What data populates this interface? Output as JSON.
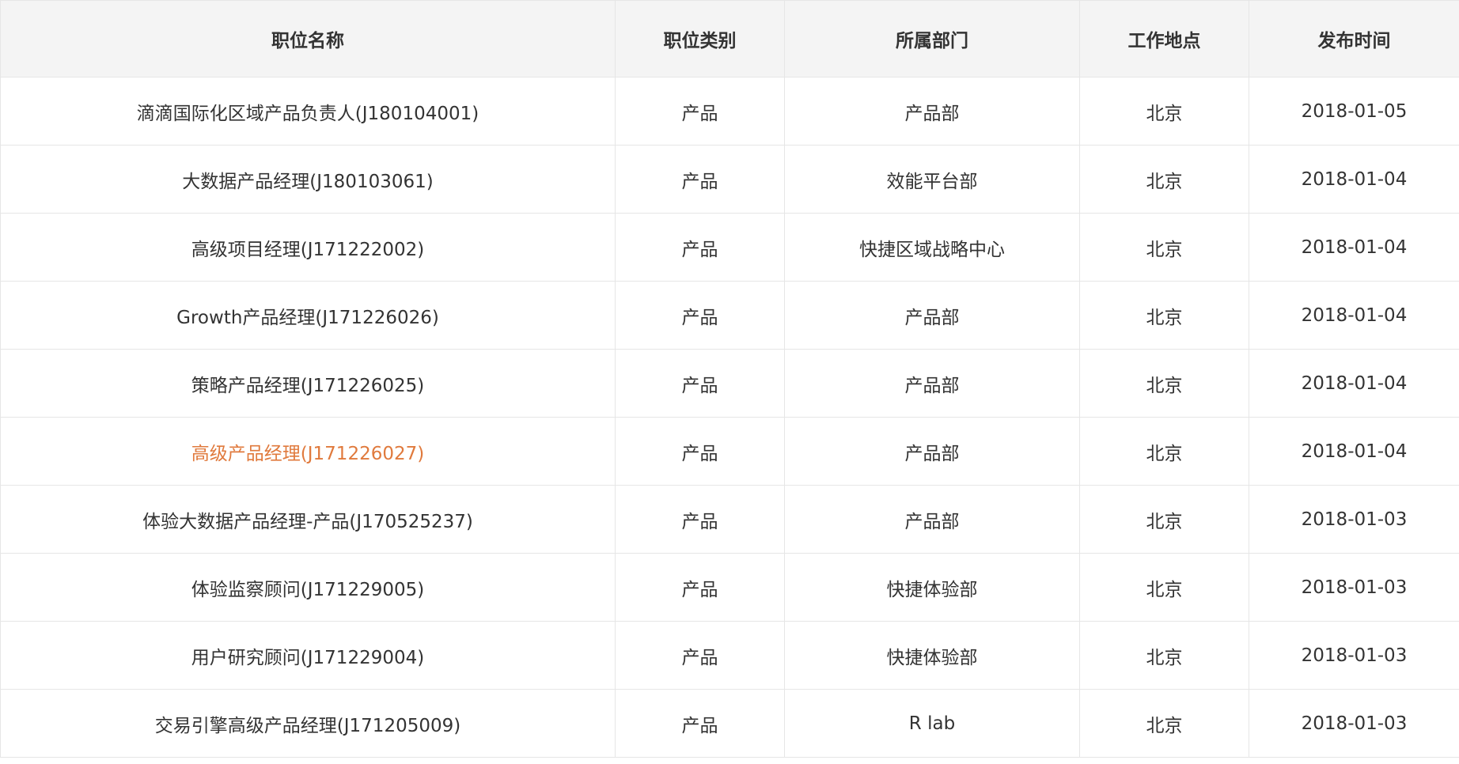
{
  "colors": {
    "header_bg": "#f4f4f4",
    "border": "#e6e6e6",
    "text": "#333333",
    "link_hover": "#e07a3d"
  },
  "table": {
    "headers": [
      "职位名称",
      "职位类别",
      "所属部门",
      "工作地点",
      "发布时间"
    ],
    "rows": [
      {
        "title": "滴滴国际化区域产品负责人(J180104001)",
        "category": "产品",
        "department": "产品部",
        "location": "北京",
        "date": "2018-01-05",
        "highlighted": false
      },
      {
        "title": "大数据产品经理(J180103061)",
        "category": "产品",
        "department": "效能平台部",
        "location": "北京",
        "date": "2018-01-04",
        "highlighted": false
      },
      {
        "title": "高级项目经理(J171222002)",
        "category": "产品",
        "department": "快捷区域战略中心",
        "location": "北京",
        "date": "2018-01-04",
        "highlighted": false
      },
      {
        "title": "Growth产品经理(J171226026)",
        "category": "产品",
        "department": "产品部",
        "location": "北京",
        "date": "2018-01-04",
        "highlighted": false
      },
      {
        "title": "策略产品经理(J171226025)",
        "category": "产品",
        "department": "产品部",
        "location": "北京",
        "date": "2018-01-04",
        "highlighted": false
      },
      {
        "title": "高级产品经理(J171226027)",
        "category": "产品",
        "department": "产品部",
        "location": "北京",
        "date": "2018-01-04",
        "highlighted": true
      },
      {
        "title": "体验大数据产品经理-产品(J170525237)",
        "category": "产品",
        "department": "产品部",
        "location": "北京",
        "date": "2018-01-03",
        "highlighted": false
      },
      {
        "title": "体验监察顾问(J171229005)",
        "category": "产品",
        "department": "快捷体验部",
        "location": "北京",
        "date": "2018-01-03",
        "highlighted": false
      },
      {
        "title": "用户研究顾问(J171229004)",
        "category": "产品",
        "department": "快捷体验部",
        "location": "北京",
        "date": "2018-01-03",
        "highlighted": false
      },
      {
        "title": "交易引擎高级产品经理(J171205009)",
        "category": "产品",
        "department": "R lab",
        "location": "北京",
        "date": "2018-01-03",
        "highlighted": false
      }
    ]
  }
}
